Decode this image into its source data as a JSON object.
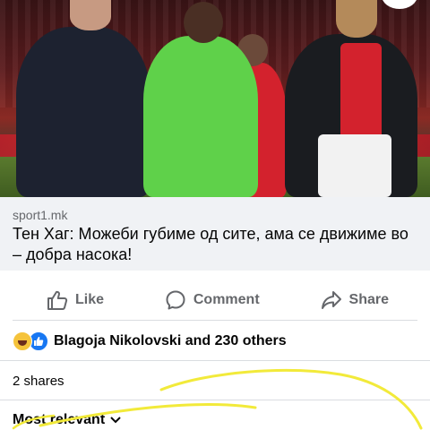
{
  "post": {
    "link": {
      "domain": "sport1.mk",
      "headline": "Тен Хаг: Можеби губиме од сите, ама се движиме во – добра насока!"
    },
    "image": {
      "description_icon": "football-photo"
    }
  },
  "actions": {
    "like_label": "Like",
    "comment_label": "Comment",
    "share_label": "Share"
  },
  "reactions": {
    "text": "Blagoja Nikolovski and 230 others",
    "icons": [
      "haha-reaction-icon",
      "like-reaction-icon"
    ]
  },
  "shares": {
    "text": "2 shares"
  },
  "comments": {
    "sort_label": "Most relevant"
  },
  "colors": {
    "link_bg": "#f0f2f5",
    "muted_text": "#65676b",
    "like_blue": "#1877f2",
    "highlight_scribble": "#f2ea3a"
  }
}
